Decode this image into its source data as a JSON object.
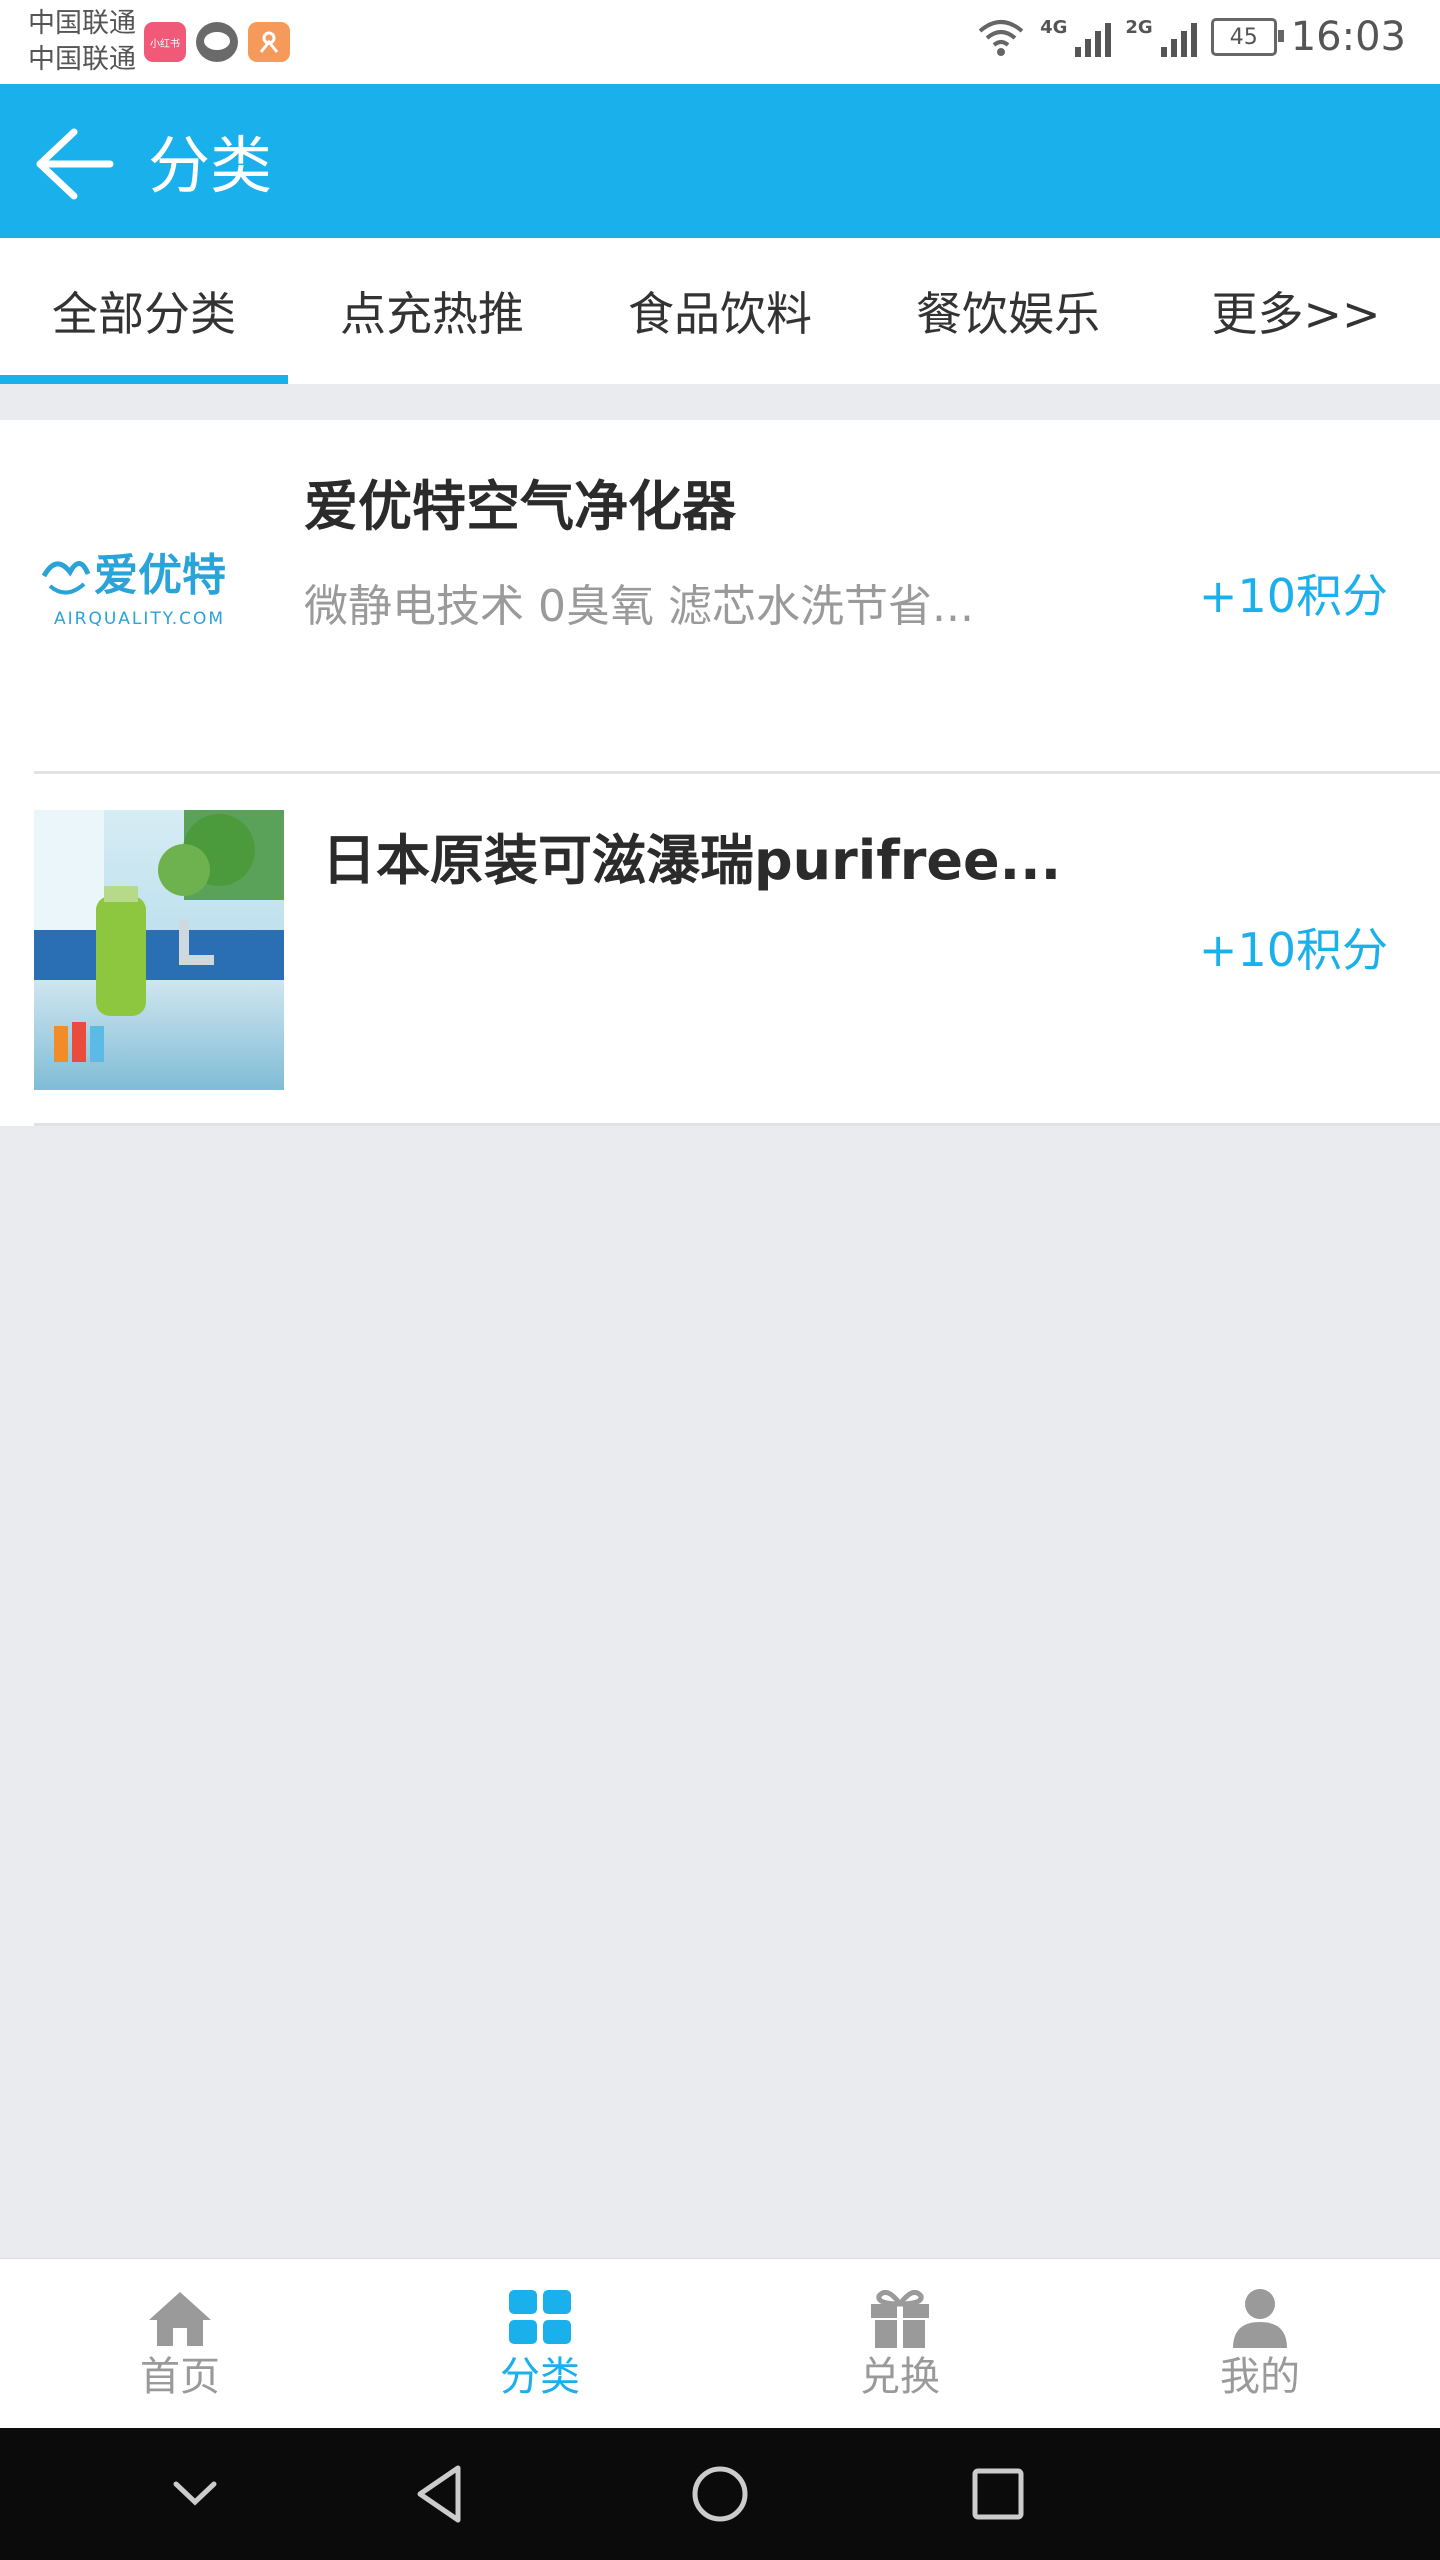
{
  "status_bar": {
    "carrier_1": "中国联通",
    "carrier_2": "中国联通",
    "app_badge_1": "小红书",
    "network_1": "4G",
    "network_2": "2G",
    "battery": "45",
    "time": "16:03"
  },
  "app_bar": {
    "title": "分类",
    "back_icon": "arrow-left-icon"
  },
  "tabs": [
    {
      "label": "全部分类",
      "active": true
    },
    {
      "label": "点充热推",
      "active": false
    },
    {
      "label": "食品饮料",
      "active": false
    },
    {
      "label": "餐饮娱乐",
      "active": false
    },
    {
      "label": "更多>>",
      "active": false
    }
  ],
  "items": [
    {
      "title": "爱优特空气净化器",
      "description": "微静电技术 0臭氧 滤芯水洗节省...",
      "points": "+10积分",
      "logo_text": "爱优特",
      "logo_sub": "AIRQUALITY.COM"
    },
    {
      "title": "日本原装可滋瀑瑞purifree...",
      "description": "",
      "points": "+10积分"
    }
  ],
  "bottom_nav": [
    {
      "label": "首页",
      "icon": "home-icon",
      "active": false
    },
    {
      "label": "分类",
      "icon": "grid-icon",
      "active": true
    },
    {
      "label": "兑换",
      "icon": "gift-icon",
      "active": false
    },
    {
      "label": "我的",
      "icon": "user-icon",
      "active": false
    }
  ],
  "colors": {
    "accent": "#1ab0ec",
    "background": "#e9ebef"
  }
}
